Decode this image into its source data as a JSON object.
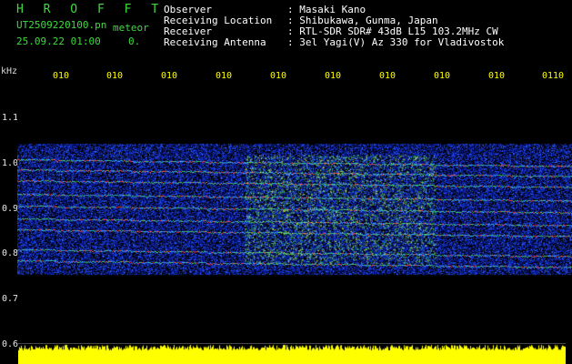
{
  "app": {
    "title": "H R O F F T"
  },
  "record": {
    "file": "UT2509220100.pn",
    "timestamp": "25.09.22 01:00",
    "tag": "meteor",
    "count": "0."
  },
  "header": {
    "rows": [
      {
        "label": "Observer",
        "value": ": Masaki Kano"
      },
      {
        "label": "Receiving Location",
        "value": ": Shibukawa, Gunma, Japan"
      },
      {
        "label": "Receiver",
        "value": ": RTL-SDR SDR# 43dB L15 103.2MHz CW"
      },
      {
        "label": "Receiving Antenna",
        "value": ": 3el Yagi(V) Az 330 for Vladivostok"
      }
    ]
  },
  "axis": {
    "y_unit": "kHz",
    "y_ticks": [
      "1.1",
      "1.0",
      "0.9",
      "0.8",
      "0.7",
      "0.6"
    ],
    "x_ticks": [
      "010",
      "010",
      "010",
      "010",
      "010",
      "010",
      "010",
      "010",
      "010",
      "0110"
    ]
  },
  "colors": {
    "background": "#000000",
    "title_green": "#3bdc3b",
    "tick_yellow": "#ffff00",
    "noise_blue": "#1030c0",
    "echo_green": "#40d060",
    "carrier_red": "#ff3030",
    "spectrum_yellow": "#ffff00"
  }
}
